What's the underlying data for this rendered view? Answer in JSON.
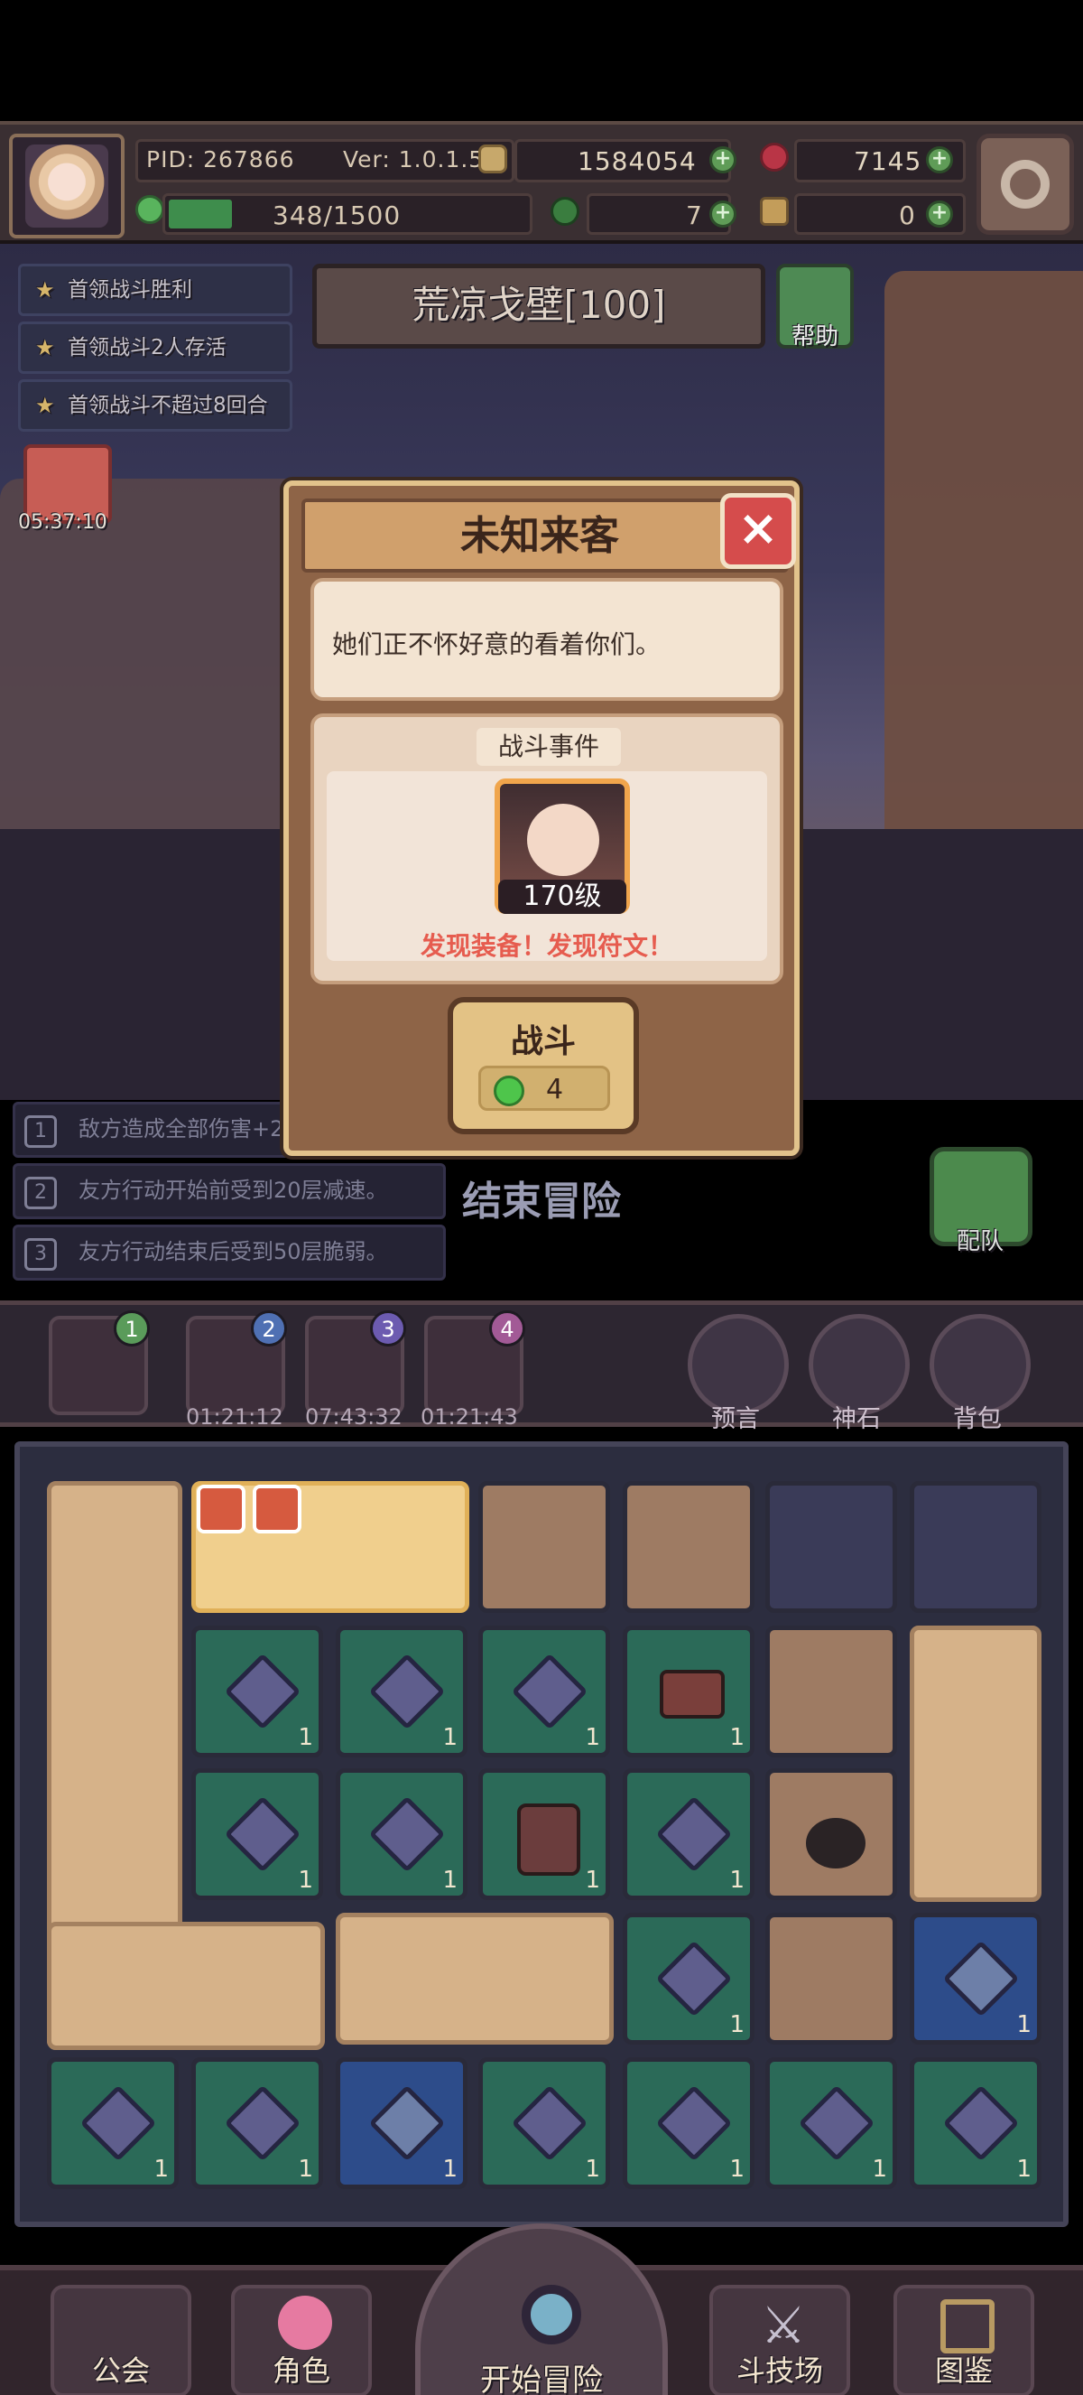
{
  "hud": {
    "pid": "PID: 267866",
    "version": "Ver: 1.0.1.5",
    "gold": "1584054",
    "gems": "7145",
    "energy": "348/1500",
    "clover": "7",
    "keys": "0"
  },
  "stage": {
    "title": "荒凉戈壁[100]",
    "help_label": "帮助",
    "gift_timer": "05:37:10"
  },
  "tasks": [
    {
      "label": "首领战斗胜利"
    },
    {
      "label": "首领战斗2人存活"
    },
    {
      "label": "首领战斗不超过8回合"
    }
  ],
  "modal": {
    "title": "未知来客",
    "message": "她们正不怀好意的看着你们。",
    "event_tag": "战斗事件",
    "level": "170级",
    "note": "发现装备！发现符文！",
    "fight_label": "战斗",
    "fight_cost": "4"
  },
  "status_lines": [
    {
      "num": "1",
      "text": "敌方造成全部伤害+2"
    },
    {
      "num": "2",
      "text": "友方行动开始前受到20层减速。"
    },
    {
      "num": "3",
      "text": "友方行动结束后受到50层脆弱。"
    }
  ],
  "end_adventure": "结束冒险",
  "team_label": "配队",
  "slots": [
    {
      "num": "1",
      "timer": ""
    },
    {
      "num": "2",
      "timer": "01:21:12"
    },
    {
      "num": "3",
      "timer": "07:43:32"
    },
    {
      "num": "4",
      "timer": "01:21:43"
    }
  ],
  "side_buttons": [
    {
      "label": "预言"
    },
    {
      "label": "神石"
    },
    {
      "label": "背包"
    }
  ],
  "grid_qty": "1",
  "nav": {
    "guild": "公会",
    "role": "角色",
    "start": "开始冒险",
    "arena": "斗技场",
    "codex": "图鉴"
  }
}
